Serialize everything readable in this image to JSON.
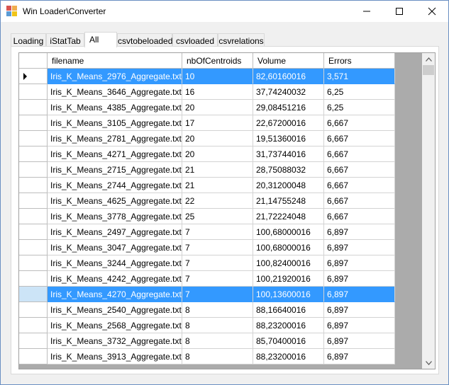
{
  "window": {
    "title": "Win Loader\\Converter"
  },
  "tabs": [
    {
      "label": "Loading"
    },
    {
      "label": "iStatTab"
    },
    {
      "label": "All"
    },
    {
      "label": "csvtobeloaded"
    },
    {
      "label": "csvloaded"
    },
    {
      "label": "csvrelations"
    }
  ],
  "active_tab": "All",
  "grid": {
    "columns": [
      "filename",
      "nbOfCentroids",
      "Volume",
      "Errors"
    ],
    "rows": [
      [
        "Iris_K_Means_2976_Aggregate.txt",
        "10",
        "82,60160016",
        "3,571"
      ],
      [
        "Iris_K_Means_3646_Aggregate.txt",
        "16",
        "37,74240032",
        "6,25"
      ],
      [
        "Iris_K_Means_4385_Aggregate.txt",
        "20",
        "29,08451216",
        "6,25"
      ],
      [
        "Iris_K_Means_3105_Aggregate.txt",
        "17",
        "22,67200016",
        "6,667"
      ],
      [
        "Iris_K_Means_2781_Aggregate.txt",
        "20",
        "19,51360016",
        "6,667"
      ],
      [
        "Iris_K_Means_4271_Aggregate.txt",
        "20",
        "31,73744016",
        "6,667"
      ],
      [
        "Iris_K_Means_2715_Aggregate.txt",
        "21",
        "28,75088032",
        "6,667"
      ],
      [
        "Iris_K_Means_2744_Aggregate.txt",
        "21",
        "20,31200048",
        "6,667"
      ],
      [
        "Iris_K_Means_4625_Aggregate.txt",
        "22",
        "21,14755248",
        "6,667"
      ],
      [
        "Iris_K_Means_3778_Aggregate.txt",
        "25",
        "21,72224048",
        "6,667"
      ],
      [
        "Iris_K_Means_2497_Aggregate.txt",
        "7",
        "100,68000016",
        "6,897"
      ],
      [
        "Iris_K_Means_3047_Aggregate.txt",
        "7",
        "100,68000016",
        "6,897"
      ],
      [
        "Iris_K_Means_3244_Aggregate.txt",
        "7",
        "100,82400016",
        "6,897"
      ],
      [
        "Iris_K_Means_4242_Aggregate.txt",
        "7",
        "100,21920016",
        "6,897"
      ],
      [
        "Iris_K_Means_4270_Aggregate.txt",
        "7",
        "100,13600016",
        "6,897"
      ],
      [
        "Iris_K_Means_2540_Aggregate.txt",
        "8",
        "88,16640016",
        "6,897"
      ],
      [
        "Iris_K_Means_2568_Aggregate.txt",
        "8",
        "88,23200016",
        "6,897"
      ],
      [
        "Iris_K_Means_3732_Aggregate.txt",
        "8",
        "85,70400016",
        "6,897"
      ],
      [
        "Iris_K_Means_3913_Aggregate.txt",
        "8",
        "88,23200016",
        "6,897"
      ]
    ],
    "selected_rows": [
      0,
      14
    ],
    "current_row": 0
  },
  "colors": {
    "selection": "#3399ff",
    "grid_background": "#ababab"
  },
  "icons": {
    "app": "app-icon",
    "minimize": "minimize-icon",
    "maximize": "maximize-icon",
    "close": "close-icon",
    "current_row": "row-pointer-icon",
    "scroll_up": "chevron-up-icon",
    "scroll_down": "chevron-down-icon"
  }
}
